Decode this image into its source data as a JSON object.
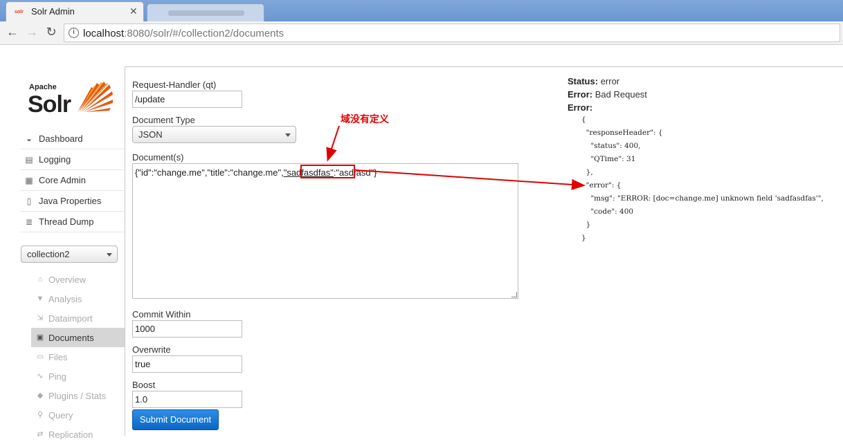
{
  "browser": {
    "active_tab_title": "Solr Admin",
    "favicon_text": "solr",
    "url_host": "localhost",
    "url_rest": ":8080/solr/#/collection2/documents"
  },
  "logo": {
    "apache": "Apache",
    "solr": "Solr"
  },
  "main_nav": [
    {
      "label": "Dashboard",
      "icon": "dashboard-icon"
    },
    {
      "label": "Logging",
      "icon": "logging-icon"
    },
    {
      "label": "Core Admin",
      "icon": "core-admin-icon"
    },
    {
      "label": "Java Properties",
      "icon": "java-properties-icon"
    },
    {
      "label": "Thread Dump",
      "icon": "thread-dump-icon"
    }
  ],
  "core_selector": {
    "value": "collection2"
  },
  "core_nav": [
    {
      "label": "Overview",
      "icon": "home-icon"
    },
    {
      "label": "Analysis",
      "icon": "filter-icon"
    },
    {
      "label": "Dataimport",
      "icon": "dataimport-icon"
    },
    {
      "label": "Documents",
      "icon": "documents-icon",
      "active": true
    },
    {
      "label": "Files",
      "icon": "folder-icon"
    },
    {
      "label": "Ping",
      "icon": "ping-icon"
    },
    {
      "label": "Plugins / Stats",
      "icon": "plugins-icon"
    },
    {
      "label": "Query",
      "icon": "query-icon"
    },
    {
      "label": "Replication",
      "icon": "replication-icon"
    }
  ],
  "form": {
    "request_handler_label": "Request-Handler (qt)",
    "request_handler_value": "/update",
    "document_type_label": "Document Type",
    "document_type_value": "JSON",
    "documents_label": "Document(s)",
    "documents_value_before": "{\"id\":\"change.me\",\"title\":\"change.me\",",
    "documents_value_field": "\"sadfasdfas\"",
    "documents_value_after": ":\"asdfasd\"}",
    "commit_within_label": "Commit Within",
    "commit_within_value": "1000",
    "overwrite_label": "Overwrite",
    "overwrite_value": "true",
    "boost_label": "Boost",
    "boost_value": "1.0",
    "submit_label": "Submit Document"
  },
  "annotation": {
    "text": "域没有定义"
  },
  "response": {
    "status_key": "Status:",
    "status_value": "error",
    "error_key": "Error:",
    "error_value": "Bad Request",
    "error_detail_key": "Error:",
    "body": "{\n  \"responseHeader\": {\n    \"status\": 400,\n    \"QTime\": 31\n  },\n  \"error\": {\n    \"msg\": \"ERROR: [doc=change.me] unknown field 'sadfasdfas'\",\n    \"code\": 400\n  }\n}"
  }
}
